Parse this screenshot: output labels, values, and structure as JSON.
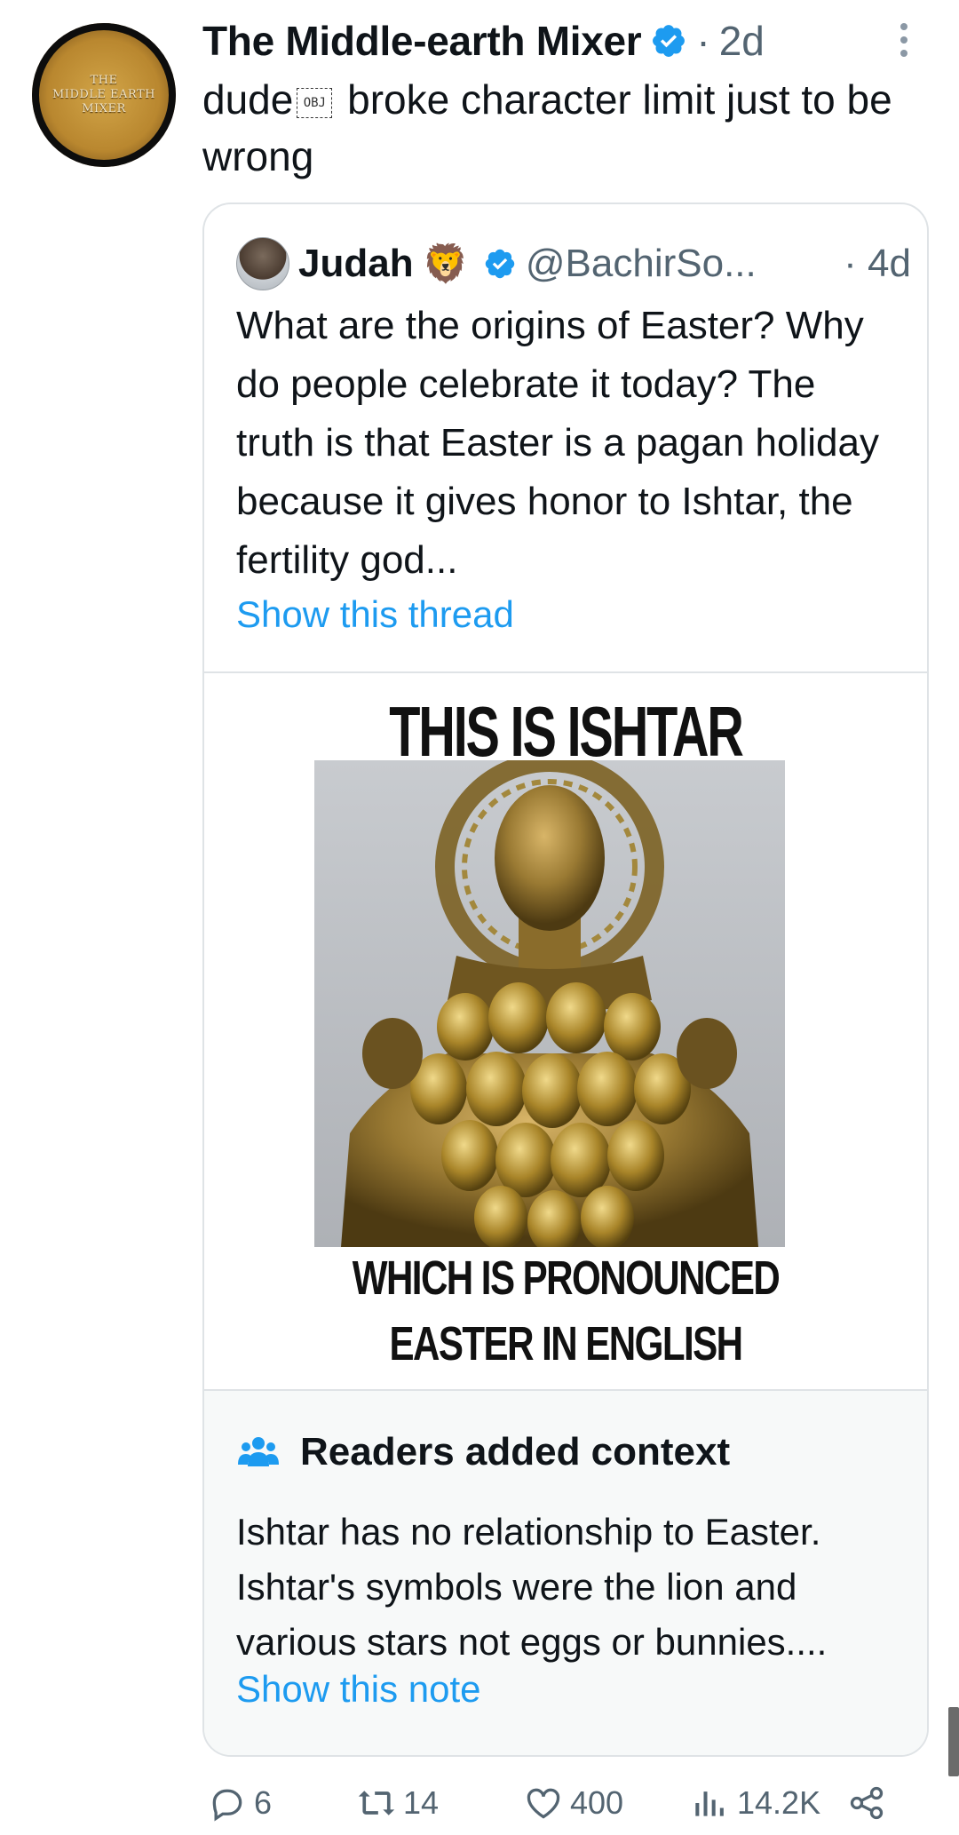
{
  "post": {
    "author": "The Middle-earth Mixer",
    "time": "2d",
    "dot": "·",
    "text_before": "dude",
    "obj": "OBJ",
    "text_after": " broke character limit just to be wrong",
    "avatar_text_1": "THE",
    "avatar_text_2": "MIDDLE EARTH",
    "avatar_text_3": "MIXER"
  },
  "quote": {
    "name": "Judah",
    "emoji": "🦁",
    "handle": "@BachirSo...",
    "time": "· 4d",
    "text": "What are the origins of Easter? Why do people celebrate it today? The truth is that Easter is a pagan holiday because it gives honor to Ishtar, the fertility god...",
    "show_thread": "Show this thread",
    "meme_top": "THIS IS ISHTAR",
    "meme_bottom": "WHICH IS PRONOUNCED EASTER IN ENGLISH"
  },
  "note": {
    "title": "Readers added context",
    "text": "Ishtar has no relationship to Easter. Ishtar's symbols were the lion and various stars not eggs or bunnies....",
    "show_note": "Show this note"
  },
  "actions": {
    "replies": "6",
    "reposts": "14",
    "likes": "400",
    "views": "14.2K"
  },
  "colors": {
    "accent": "#1d9bf0",
    "muted": "#536471",
    "border": "#dfe3e6",
    "note_bg": "#f7f9f9"
  }
}
